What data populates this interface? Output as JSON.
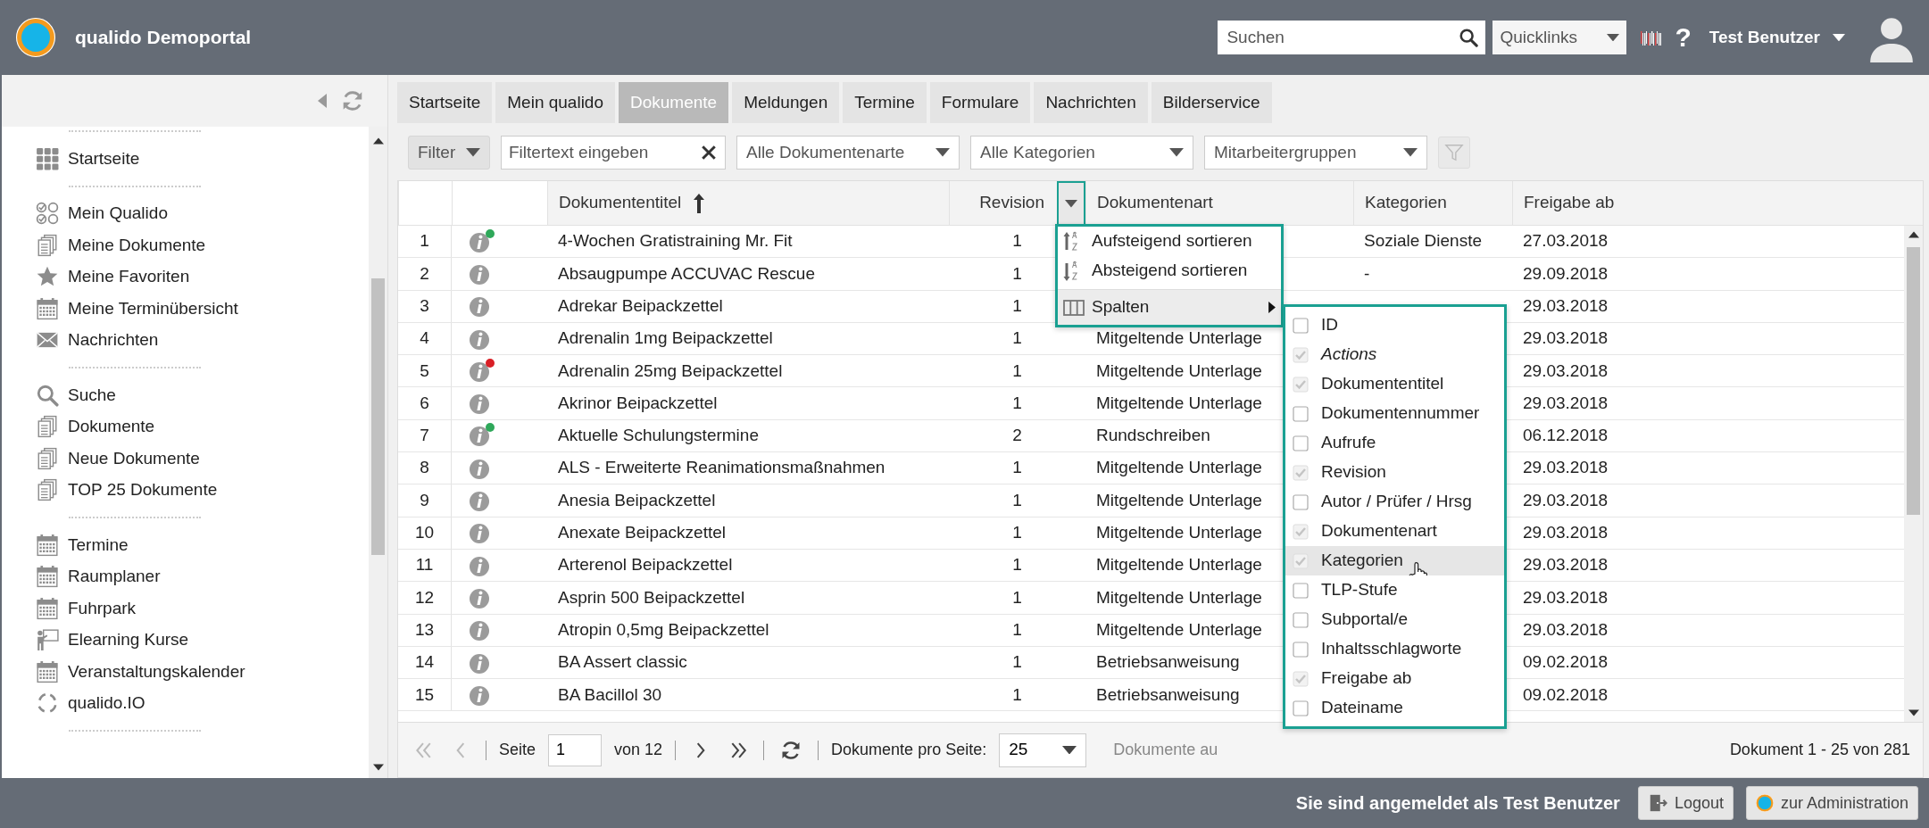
{
  "header": {
    "title": "qualido Demoportal",
    "search": {
      "placeholder": "Suchen"
    },
    "quicklinks": "Quicklinks",
    "help": "?",
    "user": "Test Benutzer"
  },
  "sidebar": {
    "groups": [
      {
        "items": [
          {
            "label": "Startseite",
            "kind": "grid"
          }
        ]
      },
      {
        "items": [
          {
            "label": "Mein Qualido",
            "kind": "checks"
          },
          {
            "label": "Meine Dokumente",
            "kind": "docs"
          },
          {
            "label": "Meine Favoriten",
            "kind": "star"
          },
          {
            "label": "Meine Terminübersicht",
            "kind": "calendar"
          },
          {
            "label": "Nachrichten",
            "kind": "mail"
          }
        ]
      },
      {
        "items": [
          {
            "label": "Suche",
            "kind": "search"
          },
          {
            "label": "Dokumente",
            "kind": "docs"
          },
          {
            "label": "Neue Dokumente",
            "kind": "docs"
          },
          {
            "label": "TOP 25 Dokumente",
            "kind": "docs"
          }
        ]
      },
      {
        "items": [
          {
            "label": "Termine",
            "kind": "calendar"
          },
          {
            "label": "Raumplaner",
            "kind": "calendar"
          },
          {
            "label": "Fuhrpark",
            "kind": "calendar"
          },
          {
            "label": "Elearning Kurse",
            "kind": "teacher"
          },
          {
            "label": "Veranstaltungskalender",
            "kind": "calendar"
          },
          {
            "label": "qualido.IO",
            "kind": "sync"
          }
        ]
      }
    ]
  },
  "tabs": [
    {
      "label": "Startseite",
      "selected": false
    },
    {
      "label": "Mein qualido",
      "selected": false
    },
    {
      "label": "Dokumente",
      "selected": true
    },
    {
      "label": "Meldungen",
      "selected": false
    },
    {
      "label": "Termine",
      "selected": false
    },
    {
      "label": "Formulare",
      "selected": false
    },
    {
      "label": "Nachrichten",
      "selected": false
    },
    {
      "label": "Bilderservice",
      "selected": false
    }
  ],
  "filters": {
    "filter_button": "Filter",
    "text": {
      "placeholder": "Filtertext eingeben"
    },
    "selects": [
      "Alle Dokumentenarte",
      "Alle Kategorien",
      "Mitarbeitergruppen"
    ]
  },
  "table": {
    "columns": [
      {
        "label": "Dokumententitel",
        "sorted": true,
        "menu_open": false
      },
      {
        "label": "Revision",
        "sorted": false,
        "menu_open": true
      },
      {
        "label": "Dokumentenart",
        "sorted": false,
        "menu_open": false
      },
      {
        "label": "Kategorien",
        "sorted": false,
        "menu_open": false
      },
      {
        "label": "Freigabe ab",
        "sorted": false,
        "menu_open": false
      }
    ],
    "rows": [
      {
        "number": "1",
        "status": {
          "color": "#2fa85a"
        },
        "title": "4-Wochen Gratistraining Mr. Fit",
        "revision": "1",
        "category": "Soziale Dienste",
        "released": "27.03.2018"
      },
      {
        "number": "2",
        "title": "Absaugpumpe ACCUVAC Rescue",
        "revision": "1",
        "category": "-",
        "released": "29.09.2018"
      },
      {
        "number": "3",
        "title": "Adrekar Beipackzettel",
        "revision": "1",
        "released": "29.03.2018"
      },
      {
        "number": "4",
        "title": "Adrenalin 1mg Beipackzettel",
        "revision": "1",
        "type": "Mitgeltende Unterlage",
        "released": "29.03.2018"
      },
      {
        "number": "5",
        "status": {
          "color": "#d91f26"
        },
        "title": "Adrenalin 25mg Beipackzettel",
        "revision": "1",
        "type": "Mitgeltende Unterlage",
        "released": "29.03.2018"
      },
      {
        "number": "6",
        "title": "Akrinor Beipackzettel",
        "revision": "1",
        "type": "Mitgeltende Unterlage",
        "released": "29.03.2018"
      },
      {
        "number": "7",
        "status": {
          "color": "#2fa85a"
        },
        "title": "Aktuelle Schulungstermine",
        "revision": "2",
        "type": "Rundschreiben",
        "released": "06.12.2018"
      },
      {
        "number": "8",
        "title": "ALS - Erweiterte Reanimationsmaßnahmen",
        "revision": "1",
        "type": "Mitgeltende Unterlage",
        "released": "29.03.2018"
      },
      {
        "number": "9",
        "title": "Anesia Beipackzettel",
        "revision": "1",
        "type": "Mitgeltende Unterlage",
        "released": "29.03.2018"
      },
      {
        "number": "10",
        "title": "Anexate Beipackzettel",
        "revision": "1",
        "type": "Mitgeltende Unterlage",
        "released": "29.03.2018"
      },
      {
        "number": "11",
        "title": "Arterenol Beipackzettel",
        "revision": "1",
        "type": "Mitgeltende Unterlage",
        "released": "29.03.2018"
      },
      {
        "number": "12",
        "title": "Asprin 500 Beipackzettel",
        "revision": "1",
        "type": "Mitgeltende Unterlage",
        "released": "29.03.2018"
      },
      {
        "number": "13",
        "title": "Atropin 0,5mg Beipackzettel",
        "revision": "1",
        "type": "Mitgeltende Unterlage",
        "released": "29.03.2018"
      },
      {
        "number": "14",
        "title": "BA Assert classic",
        "revision": "1",
        "type": "Betriebsanweisung",
        "released": "09.02.2018"
      },
      {
        "number": "15",
        "title": "BA Bacillol 30",
        "revision": "1",
        "type": "Betriebsanweisung",
        "released": "09.02.2018"
      }
    ]
  },
  "column_menu": {
    "items": [
      {
        "kind": "sort_asc",
        "label": "Aufsteigend sortieren",
        "expanded": false
      },
      {
        "kind": "sort_desc",
        "label": "Absteigend sortieren",
        "expanded": false
      },
      {
        "kind": "columns",
        "label": "Spalten",
        "expanded": true
      }
    ]
  },
  "column_chooser": {
    "items": [
      {
        "label": "ID",
        "kind": "column",
        "checked": false,
        "highlighted": false
      },
      {
        "label": "Actions",
        "kind": "fixed",
        "checked": true,
        "highlighted": false
      },
      {
        "label": "Dokumententitel",
        "kind": "column",
        "checked": true,
        "highlighted": false
      },
      {
        "label": "Dokumentennummer",
        "kind": "column",
        "checked": false,
        "highlighted": false
      },
      {
        "label": "Aufrufe",
        "kind": "column",
        "checked": false,
        "highlighted": false
      },
      {
        "label": "Revision",
        "kind": "column",
        "checked": true,
        "highlighted": false
      },
      {
        "label": "Autor / Prüfer / Hrsg",
        "kind": "column",
        "checked": false,
        "highlighted": false
      },
      {
        "label": "Dokumentenart",
        "kind": "column",
        "checked": true,
        "highlighted": false
      },
      {
        "label": "Kategorien",
        "kind": "column",
        "checked": true,
        "highlighted": true
      },
      {
        "label": "TLP-Stufe",
        "kind": "column",
        "checked": false,
        "highlighted": false
      },
      {
        "label": "Subportal/e",
        "kind": "column",
        "checked": false,
        "highlighted": false
      },
      {
        "label": "Inhaltsschlagworte",
        "kind": "column",
        "checked": false,
        "highlighted": false
      },
      {
        "label": "Freigabe ab",
        "kind": "column",
        "checked": true,
        "highlighted": false
      },
      {
        "label": "Dateiname",
        "kind": "column",
        "checked": false,
        "highlighted": false
      }
    ]
  },
  "pagination": {
    "nav": [
      {
        "kind": "first",
        "disabled": true
      },
      {
        "kind": "prev",
        "disabled": true
      },
      {
        "kind": "next",
        "disabled": false
      },
      {
        "kind": "last",
        "disabled": false
      }
    ],
    "page_label": "Seite",
    "page": "1",
    "of": "von 12",
    "per_page_label": "Dokumente pro Seite:",
    "per_page": "25",
    "scope": "Dokumente au",
    "summary": "Dokument 1 - 25 von 281"
  },
  "footer": {
    "login_text": "Sie sind angemeldet als **Test Benutzer**",
    "buttons": [
      {
        "kind": "logout",
        "label": "Logout"
      },
      {
        "kind": "admin",
        "label": "zur Administration"
      }
    ]
  }
}
